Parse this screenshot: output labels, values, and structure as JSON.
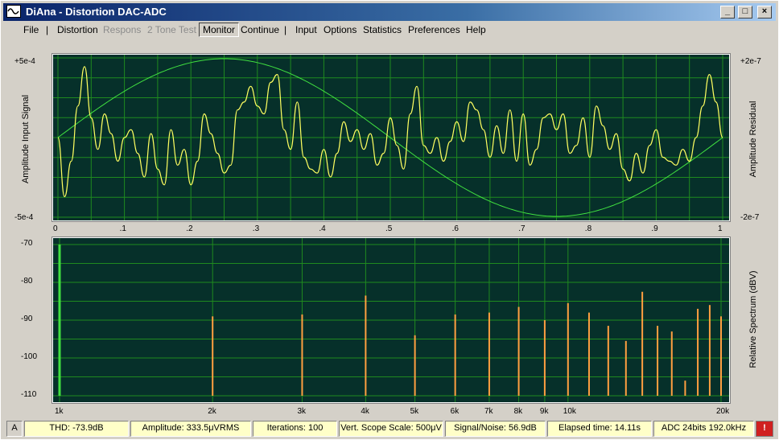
{
  "window": {
    "title": "DiAna - Distortion DAC-ADC"
  },
  "menu": [
    {
      "label": "File",
      "disabled": false
    },
    {
      "label": "Distortion",
      "disabled": false
    },
    {
      "label": "Respons",
      "disabled": true
    },
    {
      "label": "2 Tone Test",
      "disabled": true
    },
    {
      "label": "Monitor",
      "disabled": false,
      "pressed": true
    },
    {
      "label": "Continue",
      "disabled": false
    },
    {
      "label": "Input",
      "disabled": false
    },
    {
      "label": "Options",
      "disabled": false
    },
    {
      "label": "Statistics",
      "disabled": false
    },
    {
      "label": "Preferences",
      "disabled": false
    },
    {
      "label": "Help",
      "disabled": false
    }
  ],
  "scope": {
    "left_axis_label": "Amplitude Input Signal",
    "right_axis_label": "Amplitude Residual",
    "left_top": "+5e-4",
    "left_bottom": "-5e-4",
    "right_top": "+2e-7",
    "right_bottom": "-2e-7",
    "x_ticks": [
      "0",
      ".1",
      ".2",
      ".3",
      ".4",
      ".5",
      ".6",
      ".7",
      ".8",
      ".9",
      "1"
    ]
  },
  "spectrum": {
    "right_axis_label": "Relative Spectrum (dBV)",
    "y_ticks": [
      "-70",
      "-80",
      "-90",
      "-100",
      "-110"
    ],
    "x_ticks": [
      "1k",
      "2k",
      "3k",
      "4k",
      "5k",
      "6k",
      "7k",
      "8k",
      "9k",
      "10k",
      "20k"
    ]
  },
  "chart_data": [
    {
      "type": "line",
      "title": "",
      "xlabel": "",
      "ylabel": "Amplitude Input Signal",
      "xlim": [
        0,
        1
      ],
      "ylim": [
        -0.0005,
        0.0005
      ],
      "series": [
        {
          "name": "Amplitude Input Signal",
          "color": "#40e040",
          "x": [
            0,
            0.125,
            0.25,
            0.375,
            0.5,
            0.625,
            0.75,
            0.875,
            1
          ],
          "y": [
            0,
            0.00035,
            0.0005,
            0.00035,
            0,
            -0.00035,
            -0.0005,
            -0.00035,
            0
          ]
        },
        {
          "name": "Amplitude Residual",
          "color": "#ffff60",
          "x": [
            0,
            0.01,
            0.02,
            0.03,
            0.04,
            0.05,
            0.06,
            0.07,
            0.08,
            0.09,
            0.1,
            0.11,
            0.12,
            0.13,
            0.14,
            0.15,
            0.16,
            0.17,
            0.18,
            0.19,
            0.2,
            0.21,
            0.22,
            0.23,
            0.24,
            0.25,
            0.26,
            0.27,
            0.28,
            0.29,
            0.3,
            0.31,
            0.32,
            0.33,
            0.34,
            0.35,
            0.36,
            0.37,
            0.38,
            0.39,
            0.4,
            0.41,
            0.42,
            0.43,
            0.44,
            0.45,
            0.46,
            0.47,
            0.48,
            0.49,
            0.5,
            0.51,
            0.52,
            0.53,
            0.54,
            0.55,
            0.56,
            0.57,
            0.58,
            0.59,
            0.6,
            0.61,
            0.62,
            0.63,
            0.64,
            0.65,
            0.66,
            0.67,
            0.68,
            0.69,
            0.7,
            0.71,
            0.72,
            0.73,
            0.74,
            0.75,
            0.76,
            0.77,
            0.78,
            0.79,
            0.8,
            0.81,
            0.82,
            0.83,
            0.84,
            0.85,
            0.86,
            0.87,
            0.88,
            0.89,
            0.9,
            0.91,
            0.92,
            0.93,
            0.94,
            0.95,
            0.96,
            0.97,
            0.98,
            0.99,
            1
          ],
          "y": [
            0,
            -1.5e-07,
            -6e-08,
            8e-08,
            1.8e-07,
            5e-08,
            -3e-08,
            6e-08,
            1e-08,
            -6e-08,
            0,
            2e-08,
            -4e-08,
            -1e-07,
            1e-08,
            -8e-08,
            -1.2e-07,
            2e-08,
            -7e-08,
            -3e-08,
            -1.2e-07,
            -6e-08,
            6e-08,
            1e-08,
            -4e-08,
            -9e-08,
            -7e-08,
            7e-08,
            9e-08,
            1.3e-07,
            8e-08,
            6e-08,
            1.4e-07,
            1.6e-07,
            2e-08,
            -3e-08,
            9e-08,
            -5e-08,
            -8e-08,
            -9e-08,
            -3e-08,
            -1e-07,
            -4e-08,
            4e-08,
            -1e-08,
            2e-08,
            -3e-08,
            1e-08,
            -7e-08,
            -4e-08,
            5e-08,
            -2e-08,
            -8e-08,
            6e-08,
            1.3e-07,
            -2e-08,
            -4e-08,
            0,
            -6e-08,
            -1e-08,
            4e-08,
            -1e-08,
            9e-08,
            7e-08,
            2e-08,
            -5e-08,
            3e-08,
            -4e-08,
            7e-08,
            -6e-08,
            6e-08,
            -7e-08,
            -3e-08,
            5e-08,
            6e-08,
            2e-08,
            6e-08,
            -4e-08,
            -2e-08,
            5e-08,
            -5e-08,
            8e-08,
            3e-08,
            -3e-08,
            1e-08,
            -8e-08,
            -1.1e-07,
            -4e-08,
            -9e-08,
            -2e-08,
            2e-08,
            -5e-08,
            -6e-08,
            -7e-08,
            -3e-08,
            -6e-08,
            0,
            8e-08,
            1.6e-07,
            9e-08,
            0
          ]
        }
      ]
    },
    {
      "type": "bar",
      "title": "",
      "xlabel": "",
      "ylabel": "Relative Spectrum (dBV)",
      "xscale": "log",
      "xlim": [
        1000,
        20000
      ],
      "ylim": [
        -110,
        -70
      ],
      "x": [
        1000,
        2000,
        3000,
        4000,
        5000,
        6000,
        7000,
        8000,
        9000,
        10000,
        11000,
        12000,
        13000,
        14000,
        15000,
        16000,
        17000,
        18000,
        19000,
        20000
      ],
      "values": [
        -70,
        -89,
        -88.5,
        -83.5,
        -94,
        -88.5,
        -88,
        -86.5,
        -90,
        -85.5,
        -88,
        -91.5,
        -95.5,
        -82.5,
        -91.5,
        -93,
        -106,
        -87,
        -86,
        -89
      ]
    }
  ],
  "status": [
    {
      "label": "A"
    },
    {
      "label": "THD:  -73.9dB"
    },
    {
      "label": "Amplitude: 333.5μVRMS"
    },
    {
      "label": "Iterations: 100"
    },
    {
      "label": "Vert. Scope Scale: 500μV"
    },
    {
      "label": "Signal/Noise:   56.9dB"
    },
    {
      "label": "Elapsed time: 14.11s"
    },
    {
      "label": "ADC 24bits 192.0kHz"
    },
    {
      "label": "!"
    }
  ]
}
